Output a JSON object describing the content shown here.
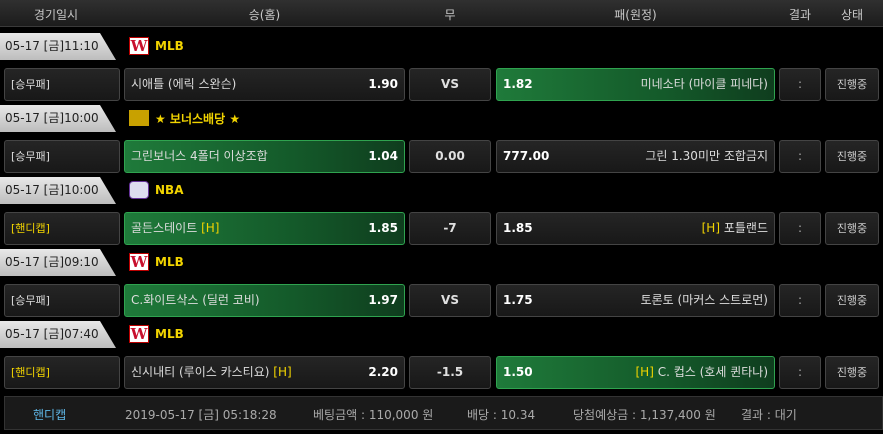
{
  "header": {
    "date": "경기일시",
    "home": "승(홈)",
    "draw": "무",
    "away": "패(원정)",
    "result": "결과",
    "status": "상태"
  },
  "rows": [
    {
      "date": "05-17 [금]11:10",
      "league": "MLB",
      "league_icon": "nationals-logo-icon",
      "type": "[승무패]",
      "home": "시애틀 (에릭 스완슨)",
      "home_odds": "1.90",
      "mid": "VS",
      "away": "미네소타 (마이클 피네다)",
      "away_odds": "1.82",
      "result": ":",
      "status": "진행중",
      "selected": "away"
    },
    {
      "date": "05-17 [금]10:00",
      "league": "★ 보너스배당 ★",
      "league_icon": "bonus-logo-icon",
      "type": "[승무패]",
      "home": "그린보너스 4폴더 이상조합",
      "home_odds": "1.04",
      "mid": "0.00",
      "away": "그린 1.30미만 조합금지",
      "away_odds": "777.00",
      "result": ":",
      "status": "진행중",
      "selected": "home"
    },
    {
      "date": "05-17 [금]10:00",
      "league": "NBA",
      "league_icon": "nba-logo-icon",
      "type": "[핸디캡]",
      "home": "골든스테이트",
      "home_flag": "[H]",
      "home_odds": "1.85",
      "mid": "-7",
      "away": "포틀랜드",
      "away_flag": "[H]",
      "away_odds": "1.85",
      "result": ":",
      "status": "진행중",
      "selected": "home"
    },
    {
      "date": "05-17 [금]09:10",
      "league": "MLB",
      "league_icon": "nationals-logo-icon",
      "type": "[승무패]",
      "home": "C.화이트삭스 (딜런 코비)",
      "home_odds": "1.97",
      "mid": "VS",
      "away": "토론토 (마커스 스트로먼)",
      "away_odds": "1.75",
      "result": ":",
      "status": "진행중",
      "selected": "home"
    },
    {
      "date": "05-17 [금]07:40",
      "league": "MLB",
      "league_icon": "nationals-logo-icon",
      "type": "[핸디캡]",
      "home": "신시내티 (루이스 카스티요)",
      "home_flag": "[H]",
      "home_odds": "2.20",
      "mid": "-1.5",
      "away": "C. 컵스 (호세 퀸타나)",
      "away_flag": "[H]",
      "away_odds": "1.50",
      "result": ":",
      "status": "진행중",
      "selected": "away"
    }
  ],
  "footer": {
    "type": "핸디캡",
    "datetime": "2019-05-17 [금] 05:18:28",
    "bet_amount": "베팅금액 : 110,000 원",
    "odds": "배당 : 10.34",
    "expected": "당첨예상금 : 1,137,400 원",
    "result": "결과 : 대기"
  },
  "colors": {
    "selected": "#1f7a3a",
    "league": "#f2d400",
    "handicap": "#f2d400",
    "footer_type": "#5fb8e8"
  }
}
